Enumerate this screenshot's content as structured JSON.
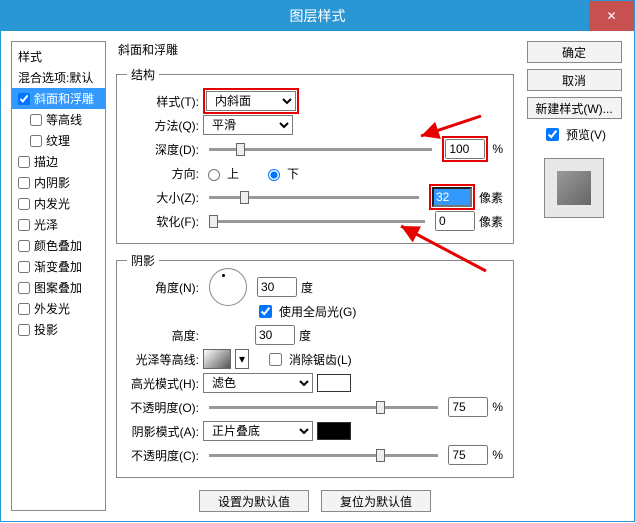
{
  "window": {
    "title": "图层样式"
  },
  "close_icon": "✕",
  "sidebar": {
    "header": "样式",
    "blend": "混合选项:默认",
    "bevel": "斜面和浮雕",
    "contour": "等高线",
    "texture": "纹理",
    "stroke": "描边",
    "inner_shadow": "内阴影",
    "inner_glow": "内发光",
    "satin": "光泽",
    "color_overlay": "颜色叠加",
    "grad_overlay": "渐变叠加",
    "pattern_overlay": "图案叠加",
    "outer_glow": "外发光",
    "drop_shadow": "投影"
  },
  "bevel": {
    "section_title": "斜面和浮雕",
    "structure_title": "结构",
    "style_label": "样式(T):",
    "style_value": "内斜面",
    "technique_label": "方法(Q):",
    "technique_value": "平滑",
    "depth_label": "深度(D):",
    "depth_value": "100",
    "pct": "%",
    "direction_label": "方向:",
    "up": "上",
    "down": "下",
    "size_label": "大小(Z):",
    "size_value": "32",
    "px": "像素",
    "soften_label": "软化(F):",
    "soften_value": "0",
    "shade_title": "阴影",
    "angle_label": "角度(N):",
    "angle_value": "30",
    "deg": "度",
    "global_light": "使用全局光(G)",
    "altitude_label": "高度:",
    "altitude_value": "30",
    "gloss_label": "光泽等高线:",
    "antialias": "消除锯齿(L)",
    "highlight_mode_label": "高光模式(H):",
    "highlight_mode_value": "滤色",
    "highlight_op_label": "不透明度(O):",
    "highlight_op_value": "75",
    "shadow_mode_label": "阴影模式(A):",
    "shadow_mode_value": "正片叠底",
    "shadow_op_label": "不透明度(C):",
    "shadow_op_value": "75",
    "make_default": "设置为默认值",
    "reset_default": "复位为默认值"
  },
  "buttons": {
    "ok": "确定",
    "cancel": "取消",
    "new_style": "新建样式(W)...",
    "preview": "预览(V)"
  }
}
